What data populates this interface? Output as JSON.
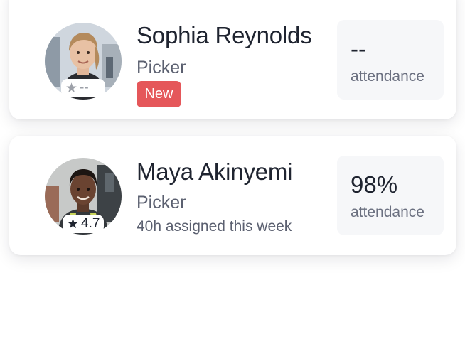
{
  "workers": [
    {
      "name": "Sophia Reynolds",
      "role": "Picker",
      "rating": "--",
      "badge": "New",
      "attendance_value": "--",
      "attendance_label": "attendance",
      "avatar_icon": "person-photo"
    },
    {
      "name": "Maya Akinyemi",
      "role": "Picker",
      "rating": "4.7",
      "hours_assigned": "40h assigned this week",
      "attendance_value": "98%",
      "attendance_label": "attendance",
      "avatar_icon": "person-photo"
    }
  ],
  "colors": {
    "badge_new": "#e5575a",
    "attendance_bg": "#f6f7f9",
    "star_empty": "#9ca0a8",
    "star_filled": "#1f2430"
  }
}
